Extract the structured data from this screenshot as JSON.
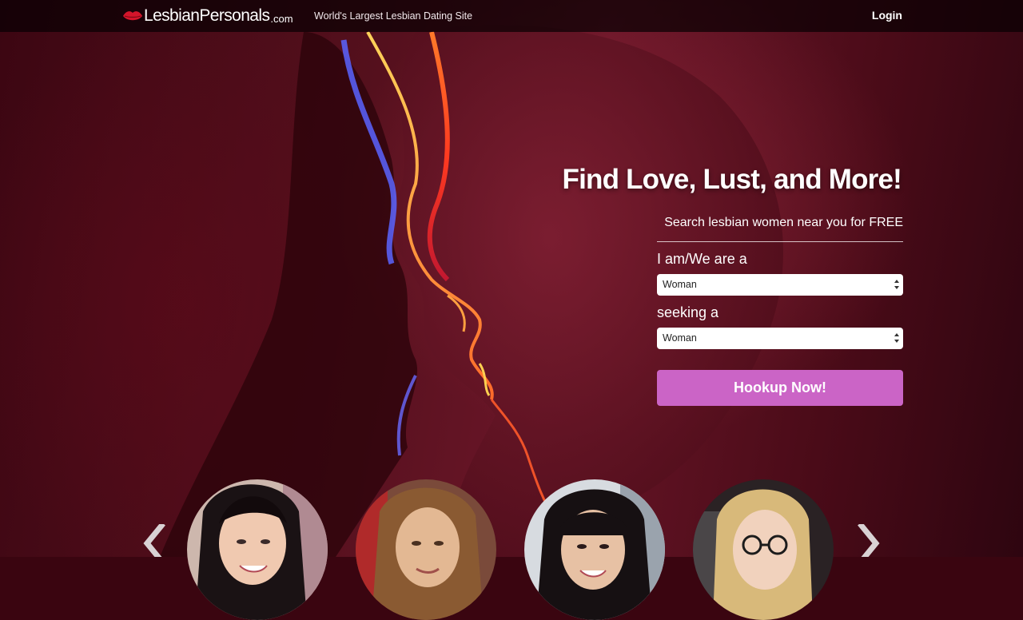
{
  "header": {
    "logo_text": "LesbianPersonals",
    "logo_domain": ".com",
    "tagline": "World's Largest Lesbian Dating Site",
    "login_label": "Login"
  },
  "hero": {
    "headline": "Find Love, Lust, and More!"
  },
  "search_form": {
    "subheading": "Search lesbian women near you for FREE",
    "gender_label": "I am/We are a",
    "gender_value": "Woman",
    "seeking_label": "seeking a",
    "seeking_value": "Woman",
    "submit_label": "Hookup Now!"
  },
  "carousel": {
    "prev_icon": "chevron-left-icon",
    "next_icon": "chevron-right-icon",
    "profiles": [
      "profile-photo-1",
      "profile-photo-2",
      "profile-photo-3",
      "profile-photo-4"
    ]
  },
  "colors": {
    "cta": "#cb64c6",
    "topbar": "#080003",
    "hero_base": "#55101d",
    "logo_lips": "#d4152b"
  }
}
